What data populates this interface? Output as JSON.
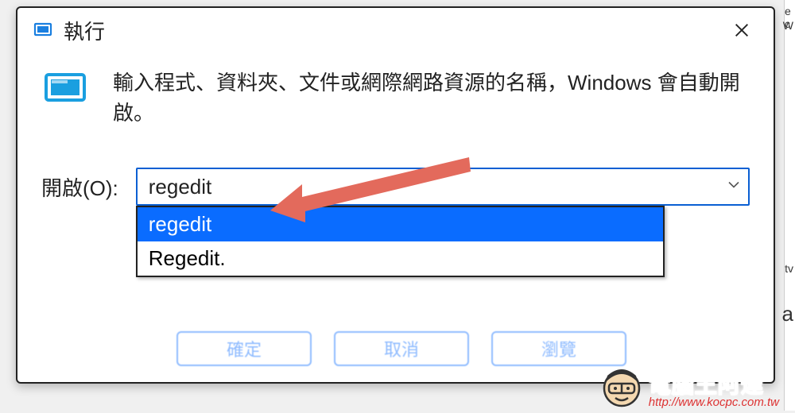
{
  "dialog": {
    "title": "執行",
    "description": "輸入程式、資料夾、文件或網際網路資源的名稱，Windows 會自動開啟。",
    "open_label": "開啟(O):",
    "input_value": "regedit",
    "dropdown": {
      "items": [
        "regedit",
        "Regedit."
      ],
      "selected_index": 0
    },
    "buttons": {
      "ok": "確定",
      "cancel": "取消",
      "browse": "瀏覽"
    }
  },
  "watermark": {
    "text": "電腦王阿達",
    "url": "http://www.kocpc.com.tw"
  }
}
